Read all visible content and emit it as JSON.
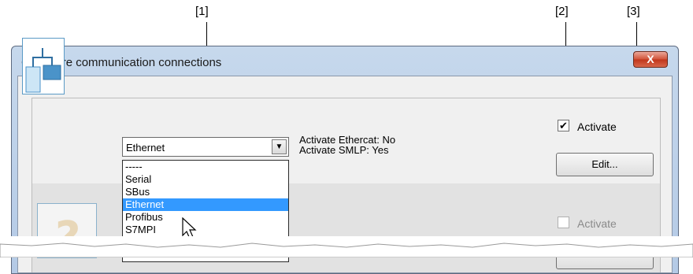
{
  "callouts": [
    "[1]",
    "[2]",
    "[3]"
  ],
  "window": {
    "title": "Configure communication connections",
    "close_glyph": "X"
  },
  "connection1": {
    "icon": "network-tree-icon",
    "selected": "Ethernet",
    "dropdown_options": [
      "-----",
      "Serial",
      "SBus",
      "Ethernet",
      "Profibus",
      "S7MPI"
    ],
    "dropdown_highlighted": "Ethernet",
    "info_line1": "Activate Ethercat: No",
    "info_line2": "Activate SMLP: Yes",
    "activate_label": "Activate",
    "activate_checked": true,
    "edit_label": "Edit..."
  },
  "connection2": {
    "icon": "question-mark-icon",
    "activate_label": "Activate",
    "activate_checked": false
  },
  "colors": {
    "selection": "#3399ff",
    "close_button": "#c8452c",
    "titlebar": "#bcd1ea",
    "icon_blue": "#4a93c9"
  }
}
